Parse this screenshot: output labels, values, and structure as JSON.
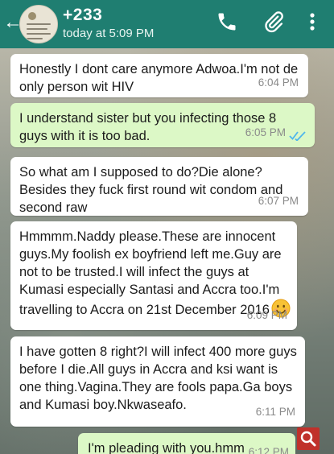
{
  "header": {
    "contact_name": "+233",
    "status": "today at 5:09 PM",
    "back_icon": "arrow-left-icon",
    "call_icon": "phone-icon",
    "attach_icon": "paperclip-icon",
    "menu_icon": "more-vertical-icon",
    "color": "#1f7e71"
  },
  "messages": [
    {
      "direction": "incoming",
      "text": "Honestly I dont care anymore Adwoa.I'm not de only person wit HIV",
      "time": "6:04 PM"
    },
    {
      "direction": "outgoing",
      "text": "I understand sister but you infecting those 8 guys with it is too bad.",
      "time": "6:05 PM",
      "status": "read"
    },
    {
      "direction": "incoming",
      "text": "So what am I supposed to do?Die alone?Besides they fuck first round wit condom and second raw",
      "time": "6:07 PM"
    },
    {
      "direction": "incoming",
      "text": "Hmmmm.Naddy please.These are innocent guys.My foolish ex boyfriend left me.Guy are not to be trusted.I will infect the guys at Kumasi especially Santasi and Accra too.I'm travelling to Accra on 21st December 2016",
      "emoji": "smiling-face-icon",
      "time": "6:09 PM"
    },
    {
      "direction": "incoming",
      "text": "I have gotten 8 right?I will infect 400 more guys before I die.All guys in Accra and ksi want is one thing.Vagina.They are fools papa.Ga boys and Kumasi boy.Nkwaseafo.",
      "time": "6:11 PM"
    },
    {
      "direction": "outgoing",
      "text": "I'm pleading with you.hmm",
      "time": "6:12 PM"
    }
  ],
  "zoom_button_icon": "magnifier-icon",
  "colors": {
    "incoming": "#ffffff",
    "outgoing": "#dcf8c6",
    "read_ticks": "#4fb6ec",
    "zoom": "#c0312b"
  }
}
